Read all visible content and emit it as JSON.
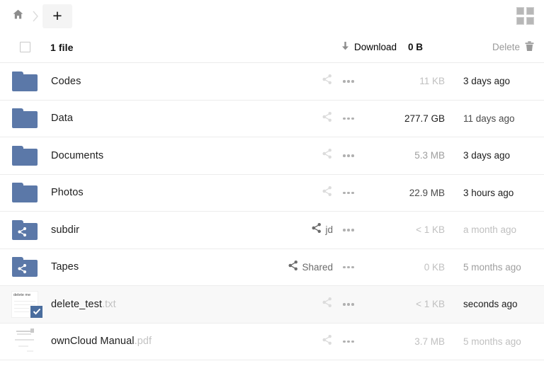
{
  "topbar": {
    "home_icon": "home-icon",
    "separator": "›",
    "new_button_label": "+",
    "grid_view_icon": "grid-view-icon"
  },
  "list_header": {
    "select_all_checked": false,
    "summary": "1 file",
    "download_label": "Download",
    "download_icon": "download-arrow-icon",
    "selected_size": "0 B",
    "delete_label": "Delete",
    "delete_icon": "trash-icon"
  },
  "rows": [
    {
      "name": "Codes",
      "ext": "",
      "kind": "folder",
      "shared": false,
      "share_label": "",
      "size": "11 KB",
      "size_tone": "dim-1",
      "date": "3 days ago",
      "date_tone": "dim-4",
      "selected": false
    },
    {
      "name": "Data",
      "ext": "",
      "kind": "folder",
      "shared": false,
      "share_label": "",
      "size": "277.7 GB",
      "size_tone": "dim-4",
      "date": "11 days ago",
      "date_tone": "dim-3",
      "selected": false
    },
    {
      "name": "Documents",
      "ext": "",
      "kind": "folder",
      "shared": false,
      "share_label": "",
      "size": "5.3 MB",
      "size_tone": "dim-2",
      "date": "3 days ago",
      "date_tone": "dim-4",
      "selected": false
    },
    {
      "name": "Photos",
      "ext": "",
      "kind": "folder",
      "shared": false,
      "share_label": "",
      "size": "22.9 MB",
      "size_tone": "dim-3",
      "date": "3 hours ago",
      "date_tone": "dim-4",
      "selected": false
    },
    {
      "name": "subdir",
      "ext": "",
      "kind": "folder-shared",
      "shared": true,
      "share_label": "jd",
      "size": "< 1 KB",
      "size_tone": "dim-1",
      "date": "a month ago",
      "date_tone": "dim-1",
      "selected": false
    },
    {
      "name": "Tapes",
      "ext": "",
      "kind": "folder-shared",
      "shared": true,
      "share_label": "Shared",
      "size": "0 KB",
      "size_tone": "dim-1",
      "date": "5 months ago",
      "date_tone": "dim-2",
      "selected": false
    },
    {
      "name": "delete_test",
      "ext": ".txt",
      "kind": "text-file",
      "thumbnail_text": "delete me",
      "shared": false,
      "share_label": "",
      "size": "< 1 KB",
      "size_tone": "dim-1",
      "date": "seconds ago",
      "date_tone": "dim-4",
      "selected": true
    },
    {
      "name": "ownCloud Manual",
      "ext": ".pdf",
      "kind": "pdf-file",
      "shared": false,
      "share_label": "",
      "size": "3.7 MB",
      "size_tone": "dim-1",
      "date": "5 months ago",
      "date_tone": "dim-1",
      "selected": false
    }
  ],
  "colors": {
    "folder_blue": "#5b78a8",
    "checkbox_blue": "#4a6d9e",
    "selected_row_bg": "#f8f8f8",
    "muted_text": "#9a9a9a"
  }
}
